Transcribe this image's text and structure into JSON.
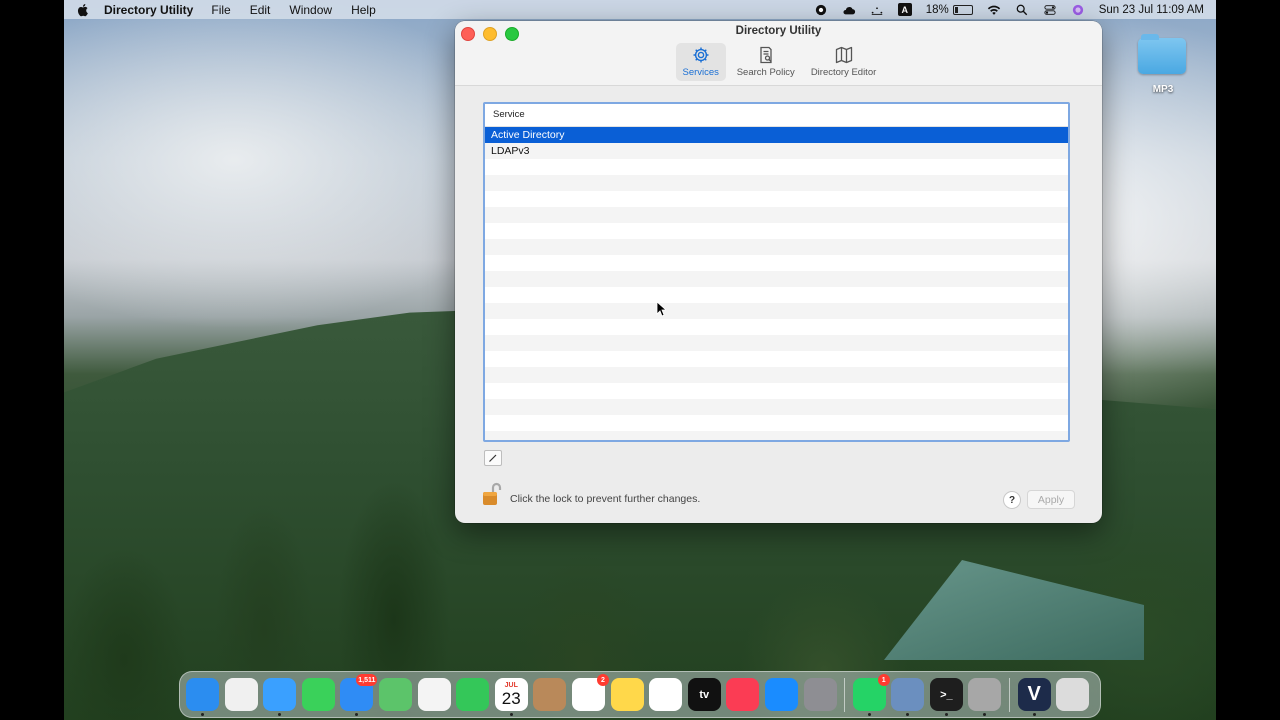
{
  "menubar": {
    "app_name": "Directory Utility",
    "menus": [
      "File",
      "Edit",
      "Window",
      "Help"
    ],
    "battery": "18%",
    "battery_level": 0.18,
    "datetime": "Sun 23 Jul  11:09 AM",
    "input_source": "A"
  },
  "desktop": {
    "folder_label": "MP3"
  },
  "window": {
    "title": "Directory Utility",
    "tabs": [
      {
        "label": "Services",
        "icon": "gear-icon",
        "active": true
      },
      {
        "label": "Search Policy",
        "icon": "search-policy-icon",
        "active": false
      },
      {
        "label": "Directory Editor",
        "icon": "map-icon",
        "active": false
      }
    ],
    "table": {
      "header": "Service",
      "rows": [
        "Active Directory",
        "LDAPv3"
      ],
      "selected_index": 0
    },
    "lock_text": "Click the lock to prevent further changes.",
    "help_label": "?",
    "apply_label": "Apply"
  },
  "dock": {
    "apps": [
      {
        "name": "finder",
        "color": "#2b8df0"
      },
      {
        "name": "launchpad",
        "color": "#f0f0f0"
      },
      {
        "name": "safari",
        "color": "#3aa0ff"
      },
      {
        "name": "messages",
        "color": "#3ad15a"
      },
      {
        "name": "mail",
        "color": "#2f8cf5",
        "badge": "1,511"
      },
      {
        "name": "maps",
        "color": "#5cc46a"
      },
      {
        "name": "photos",
        "color": "#f4f4f4"
      },
      {
        "name": "facetime",
        "color": "#34c759"
      },
      {
        "name": "calendar",
        "month": "JUL",
        "day": "23"
      },
      {
        "name": "contacts",
        "color": "#b9895a"
      },
      {
        "name": "reminders",
        "color": "#ffffff",
        "badge": "2"
      },
      {
        "name": "notes",
        "color": "#ffd84a"
      },
      {
        "name": "freeform",
        "color": "#ffffff"
      },
      {
        "name": "apple-tv",
        "color": "#111111",
        "text": "tv"
      },
      {
        "name": "music",
        "color": "#fb3c54"
      },
      {
        "name": "app-store",
        "color": "#1a8cff"
      },
      {
        "name": "system-settings",
        "color": "#8e8e93"
      },
      {
        "name": "whatsapp",
        "color": "#25d366",
        "badge": "1"
      },
      {
        "name": "preview",
        "color": "#6b8fbf"
      },
      {
        "name": "terminal",
        "color": "#1e1e1e",
        "text": ">_"
      },
      {
        "name": "directory-utility",
        "color": "#a7a7a7"
      },
      {
        "name": "v-app",
        "color": "#1d2b4a",
        "text": "V"
      },
      {
        "name": "trash",
        "color": "#dcdcdc"
      }
    ]
  }
}
